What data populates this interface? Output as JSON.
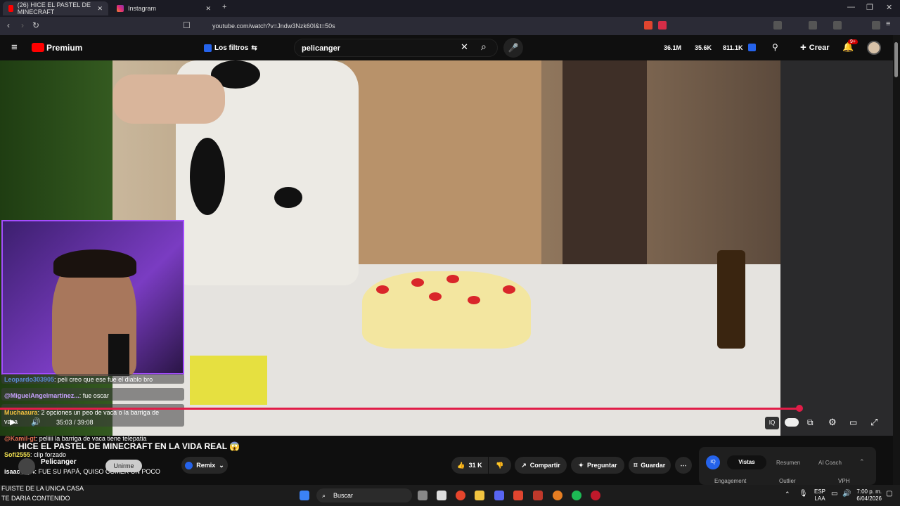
{
  "browser": {
    "tabs": [
      {
        "label": "(26) HICE EL PASTEL DE MINECRAFT",
        "active": true
      },
      {
        "label": "Instagram",
        "active": false
      }
    ],
    "url": "youtube.com/watch?v=Jndw3Nzk60I&t=50s"
  },
  "youtube": {
    "logo": "Premium",
    "filters_label": "Los filtros",
    "search_value": "pelicanger",
    "stats": [
      "36.1M",
      "35.6K",
      "811.1K"
    ],
    "create_label": "Crear",
    "notif_count": "9+"
  },
  "video": {
    "time": "35:03 / 39:08",
    "progress": 0.895,
    "title": "HICE EL PASTEL DE MINECRAFT EN LA VIDA REAL 😱"
  },
  "chat": [
    {
      "user": "Leopardo303905",
      "msg": ": peli creo que ese fue el diablo bro"
    },
    {
      "user": "@MiguelAngelmartinez...",
      "msg": ": fue oscar"
    },
    {
      "user": "Muchaaura",
      "msg": ": 2 opciones un peo de vaca o la barriga de"
    },
    {
      "user": "",
      "msg": "vaca"
    },
    {
      "user": "@Kamil-gt",
      "msg": ": peliiii la barriga de vaca tiene telepatia"
    },
    {
      "user": "Sofi2555",
      "msg": ": clip forzado"
    },
    {
      "user": "isaac_tip4",
      "msg": ": FUE SU PAPÁ, QUISO COMER UN POCO"
    }
  ],
  "overlay_text": [
    "FUISTE DE LA UNICA CASA",
    "TE DARIA CONTENIDO"
  ],
  "channel": {
    "name": "Pelicanger",
    "join": "Unirme"
  },
  "actions": {
    "remix": "Remix",
    "likes": "31 K",
    "share": "Compartir",
    "ask": "Preguntar",
    "save": "Guardar"
  },
  "sidepanel": {
    "tabs": [
      "Vistas",
      "Resumen",
      "AI Coach"
    ],
    "columns": [
      "Engagement",
      "Outlier",
      "VPH"
    ]
  },
  "taskbar": {
    "search": "Buscar",
    "lang": [
      "ESP",
      "LAA"
    ],
    "clock": [
      "7:00 p. m.",
      "6/04/2026"
    ]
  }
}
